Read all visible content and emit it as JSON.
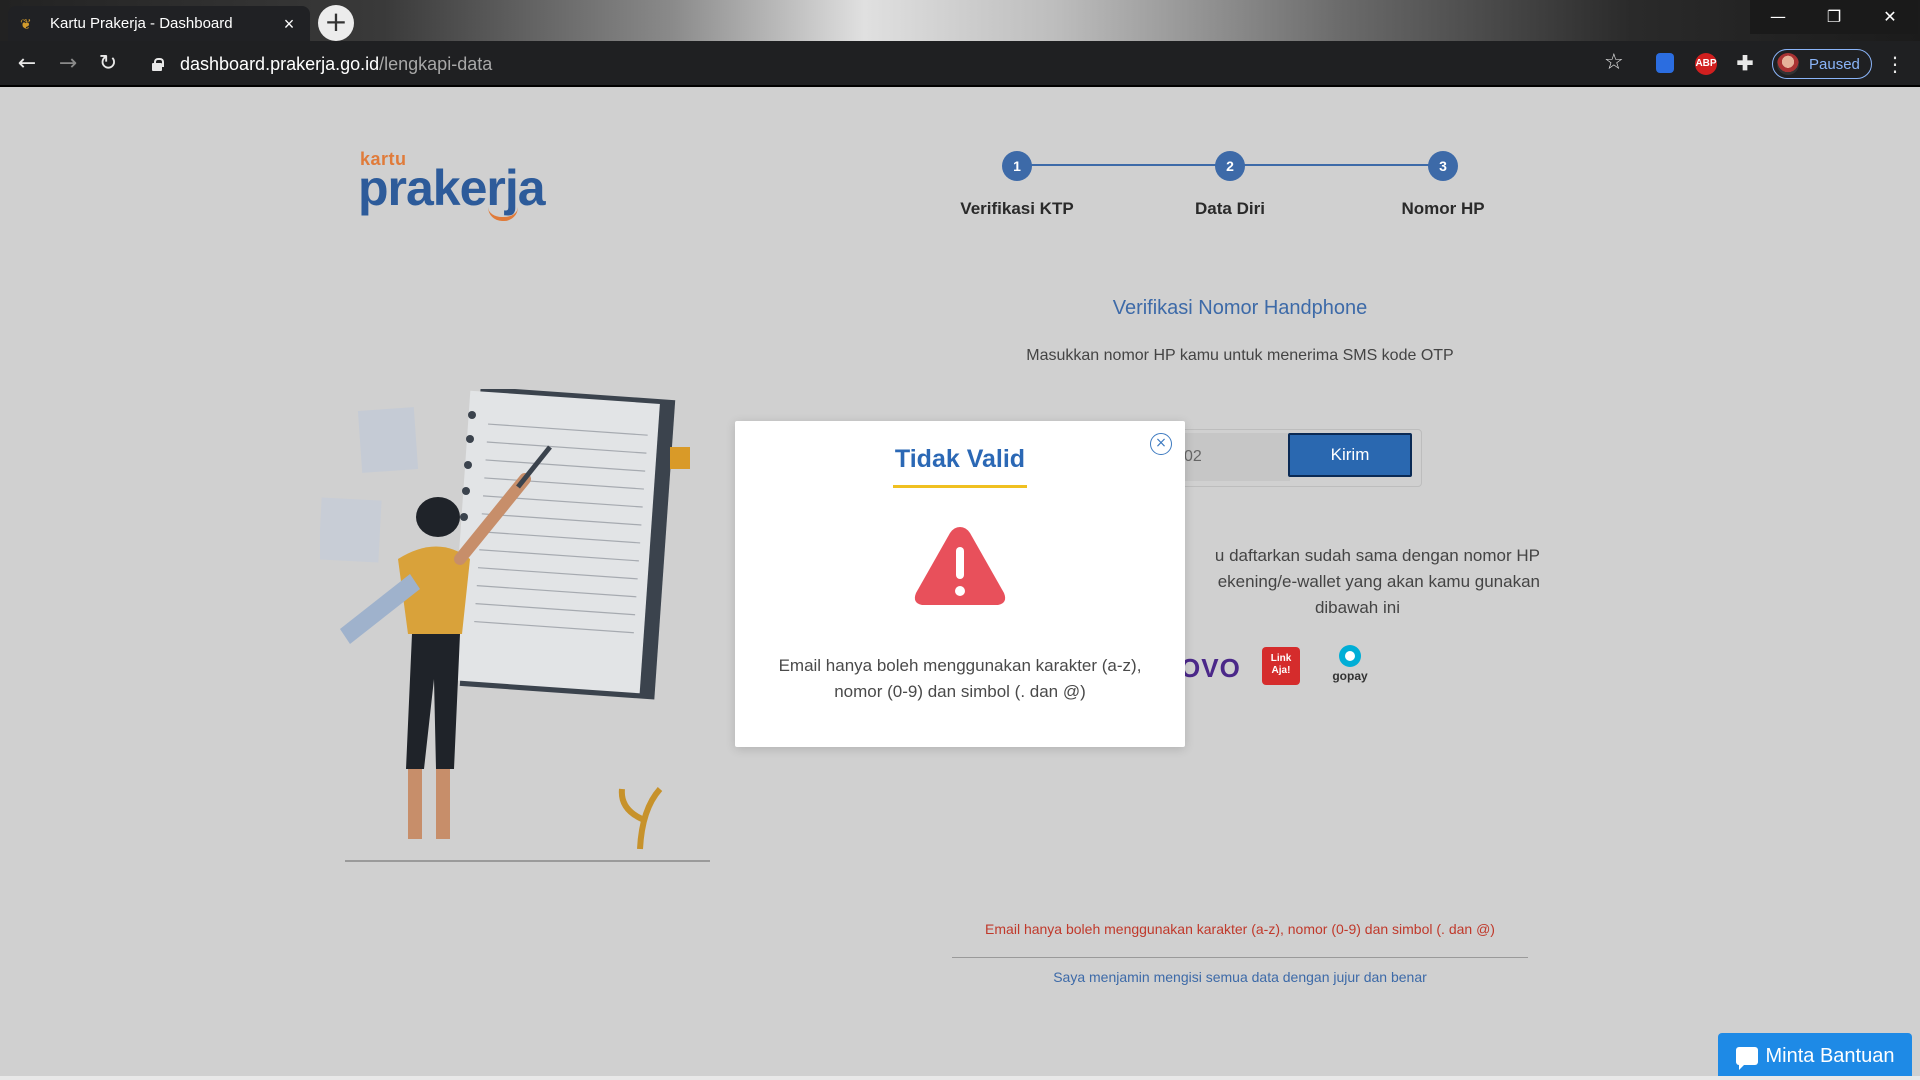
{
  "browser": {
    "tab_title": "Kartu Prakerja - Dashboard",
    "url_domain": "dashboard.prakerja.go.id",
    "url_path": "/lengkapi-data",
    "profile_label": "Paused",
    "ext_abp_label": "ABP"
  },
  "logo": {
    "small": "kartu",
    "big": "prakerja"
  },
  "stepper": {
    "steps": [
      {
        "number": "1",
        "label": "Verifikasi KTP"
      },
      {
        "number": "2",
        "label": "Data Diri"
      },
      {
        "number": "3",
        "label": "Nomor HP"
      }
    ]
  },
  "form": {
    "heading": "Verifikasi Nomor Handphone",
    "subtext": "Masukkan nomor HP kamu untuk menerima SMS kode OTP",
    "phone_value": "02",
    "send_button": "Kirim",
    "note_line1": "u daftarkan sudah sama dengan nomor HP",
    "note_line2": "ekening/e-wallet yang akan kamu gunakan",
    "note_line3": "dibawah ini"
  },
  "wallets": {
    "ovo": "OVO",
    "linkaja_line1": "Link",
    "linkaja_line2": "Aja!",
    "gopay": "gopay"
  },
  "footer": {
    "error": "Email hanya boleh menggunakan karakter (a-z), nomor (0-9) dan simbol (. dan @)",
    "pledge": "Saya menjamin mengisi semua data dengan jujur dan benar"
  },
  "help_button": "Minta Bantuan",
  "modal": {
    "title": "Tidak Valid",
    "message_line1": "Email hanya boleh menggunakan karakter (a-z),",
    "message_line2": "nomor (0-9) dan simbol (. dan @)"
  },
  "colors": {
    "primary": "#2b68b5",
    "accent_yellow": "#f0c020",
    "error_red": "#c0392b",
    "warning_icon": "#e8505b",
    "help_blue": "#1e8ae6"
  }
}
